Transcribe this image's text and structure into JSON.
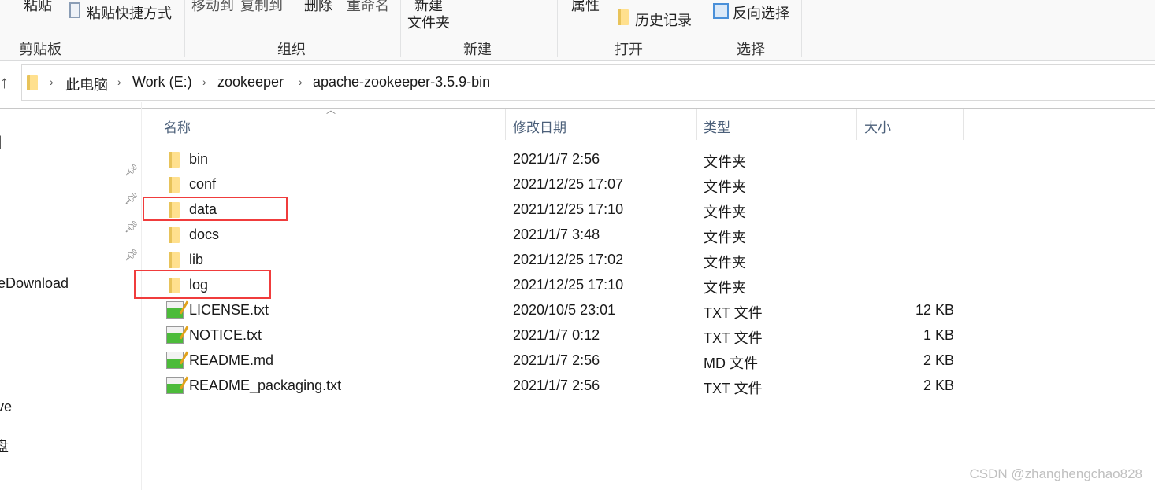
{
  "ribbon": {
    "clipboard": {
      "paste": "粘贴",
      "paste_shortcut": "粘贴快捷方式",
      "group": "剪贴板"
    },
    "organize": {
      "move_to": "移动到",
      "copy_to": "复制到",
      "delete": "删除",
      "rename": "重命名",
      "group": "组织"
    },
    "new": {
      "new_folder_line1": "新建",
      "new_folder_line2": "文件夹",
      "group": "新建"
    },
    "open": {
      "properties": "属性",
      "history": "历史记录",
      "group": "打开"
    },
    "select": {
      "invert": "反向选择",
      "group": "选择"
    }
  },
  "address": {
    "crumbs": [
      "此电脑",
      "Work (E:)",
      "zookeeper",
      "apache-zookeeper-3.5.9-bin"
    ]
  },
  "nav": {
    "items": [
      "]",
      "eDownload",
      "ve",
      "盘"
    ]
  },
  "columns": {
    "name": "名称",
    "date": "修改日期",
    "type": "类型",
    "size": "大小"
  },
  "files": [
    {
      "name": "bin",
      "date": "2021/1/7 2:56",
      "type": "文件夹",
      "size": "",
      "icon": "folder-icon"
    },
    {
      "name": "conf",
      "date": "2021/12/25 17:07",
      "type": "文件夹",
      "size": "",
      "icon": "folder-icon"
    },
    {
      "name": "data",
      "date": "2021/12/25 17:10",
      "type": "文件夹",
      "size": "",
      "icon": "folder-icon",
      "highlighted": true
    },
    {
      "name": "docs",
      "date": "2021/1/7 3:48",
      "type": "文件夹",
      "size": "",
      "icon": "folder-icon"
    },
    {
      "name": "lib",
      "date": "2021/12/25 17:02",
      "type": "文件夹",
      "size": "",
      "icon": "folder-icon"
    },
    {
      "name": "log",
      "date": "2021/12/25 17:10",
      "type": "文件夹",
      "size": "",
      "icon": "folder-icon",
      "highlighted": true
    },
    {
      "name": "LICENSE.txt",
      "date": "2020/10/5 23:01",
      "type": "TXT 文件",
      "size": "12 KB",
      "icon": "text-file-icon"
    },
    {
      "name": "NOTICE.txt",
      "date": "2021/1/7 0:12",
      "type": "TXT 文件",
      "size": "1 KB",
      "icon": "text-file-icon"
    },
    {
      "name": "README.md",
      "date": "2021/1/7 2:56",
      "type": "MD 文件",
      "size": "2 KB",
      "icon": "text-file-icon"
    },
    {
      "name": "README_packaging.txt",
      "date": "2021/1/7 2:56",
      "type": "TXT 文件",
      "size": "2 KB",
      "icon": "text-file-icon"
    }
  ],
  "highlight_color": "#f03c3c",
  "watermark": "CSDN @zhanghengchao828"
}
